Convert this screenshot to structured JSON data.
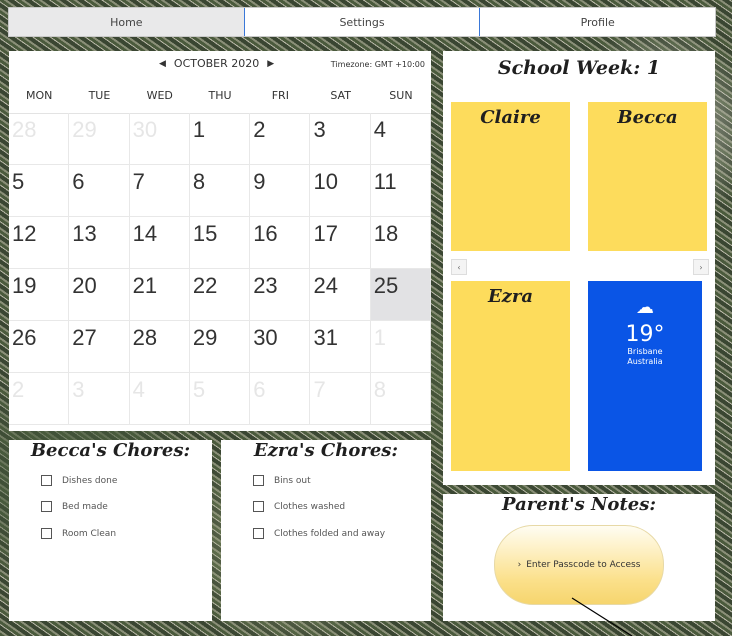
{
  "nav": {
    "tabs": [
      "Home",
      "Settings",
      "Profile"
    ],
    "active": "Home"
  },
  "calendar": {
    "month_label": "OCTOBER 2020",
    "timezone": "Timezone: GMT +10:00",
    "weekdays": [
      "MON",
      "TUE",
      "WED",
      "THU",
      "FRI",
      "SAT",
      "SUN"
    ],
    "days": [
      {
        "d": "28",
        "out": true
      },
      {
        "d": "29",
        "out": true
      },
      {
        "d": "30",
        "out": true
      },
      {
        "d": "1"
      },
      {
        "d": "2"
      },
      {
        "d": "3"
      },
      {
        "d": "4"
      },
      {
        "d": "5"
      },
      {
        "d": "6"
      },
      {
        "d": "7"
      },
      {
        "d": "8"
      },
      {
        "d": "9"
      },
      {
        "d": "10"
      },
      {
        "d": "11"
      },
      {
        "d": "12"
      },
      {
        "d": "13"
      },
      {
        "d": "14"
      },
      {
        "d": "15"
      },
      {
        "d": "16"
      },
      {
        "d": "17"
      },
      {
        "d": "18"
      },
      {
        "d": "19"
      },
      {
        "d": "20"
      },
      {
        "d": "21"
      },
      {
        "d": "22"
      },
      {
        "d": "23"
      },
      {
        "d": "24"
      },
      {
        "d": "25",
        "today": true
      },
      {
        "d": "26"
      },
      {
        "d": "27"
      },
      {
        "d": "28"
      },
      {
        "d": "29"
      },
      {
        "d": "30"
      },
      {
        "d": "31"
      },
      {
        "d": "1",
        "out": true
      },
      {
        "d": "2",
        "out": true
      },
      {
        "d": "3",
        "out": true
      },
      {
        "d": "4",
        "out": true
      },
      {
        "d": "5",
        "out": true
      },
      {
        "d": "6",
        "out": true
      },
      {
        "d": "7",
        "out": true
      },
      {
        "d": "8",
        "out": true
      }
    ]
  },
  "school_week": {
    "title": "School Week: 1",
    "cards": [
      "Claire",
      "Becca",
      "Ezra"
    ],
    "card_color": "#fddc5c"
  },
  "weather": {
    "temp": "19°",
    "city": "Brisbane",
    "country": "Australia",
    "icon": "cloud-sun-icon",
    "color": "#0a55e6"
  },
  "becca_chores": {
    "title": "Becca's Chores:",
    "items": [
      "Dishes done",
      "Bed made",
      "Room Clean"
    ]
  },
  "ezra_chores": {
    "title": "Ezra's Chores:",
    "items": [
      "Bins out",
      "Clothes washed",
      "Clothes folded and away"
    ]
  },
  "parents_notes": {
    "title": "Parent's Notes:",
    "button": "Enter Passcode to Access"
  }
}
